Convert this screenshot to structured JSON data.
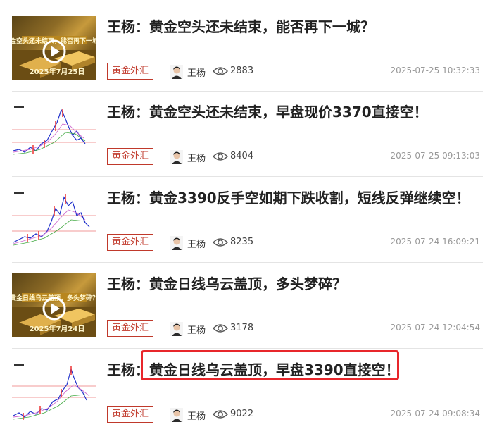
{
  "articles": [
    {
      "title": "王杨：黄金空头还未结束，能否再下一城？",
      "tag": "黄金外汇",
      "author": "王杨",
      "views": "2883",
      "time": "2025-07-25 10:32:33",
      "thumb_type": "video",
      "thumb_caption_top": "黄金空头还未结束，能否再下一城？",
      "thumb_caption_bottom": "2025年7月25日"
    },
    {
      "title": "王杨：黄金空头还未结束，早盘现价3370直接空！",
      "tag": "黄金外汇",
      "author": "王杨",
      "views": "8404",
      "time": "2025-07-25 09:13:03",
      "thumb_type": "chart"
    },
    {
      "title": "王杨：黄金3390反手空如期下跌收割，短线反弹继续空！",
      "tag": "黄金外汇",
      "author": "王杨",
      "views": "8235",
      "time": "2025-07-24 16:09:21",
      "thumb_type": "chart"
    },
    {
      "title": "王杨：黄金日线乌云盖顶，多头梦碎？",
      "tag": "黄金外汇",
      "author": "王杨",
      "views": "3178",
      "time": "2025-07-24 12:04:54",
      "thumb_type": "video",
      "thumb_caption_top": "黄金日线乌云盖顶，多头梦碎？",
      "thumb_caption_bottom": "2025年7月24日"
    },
    {
      "title": "王杨：黄金日线乌云盖顶，早盘3390直接空！",
      "tag": "黄金外汇",
      "author": "王杨",
      "views": "9022",
      "time": "2025-07-24 09:08:34",
      "thumb_type": "chart"
    }
  ],
  "colors": {
    "tag_red": "#c0392b",
    "highlight_red": "#e8262b",
    "gold": "#c79a3c"
  },
  "icons": {
    "play": "play-icon",
    "views": "eye-icon",
    "avatar": "author-avatar"
  }
}
